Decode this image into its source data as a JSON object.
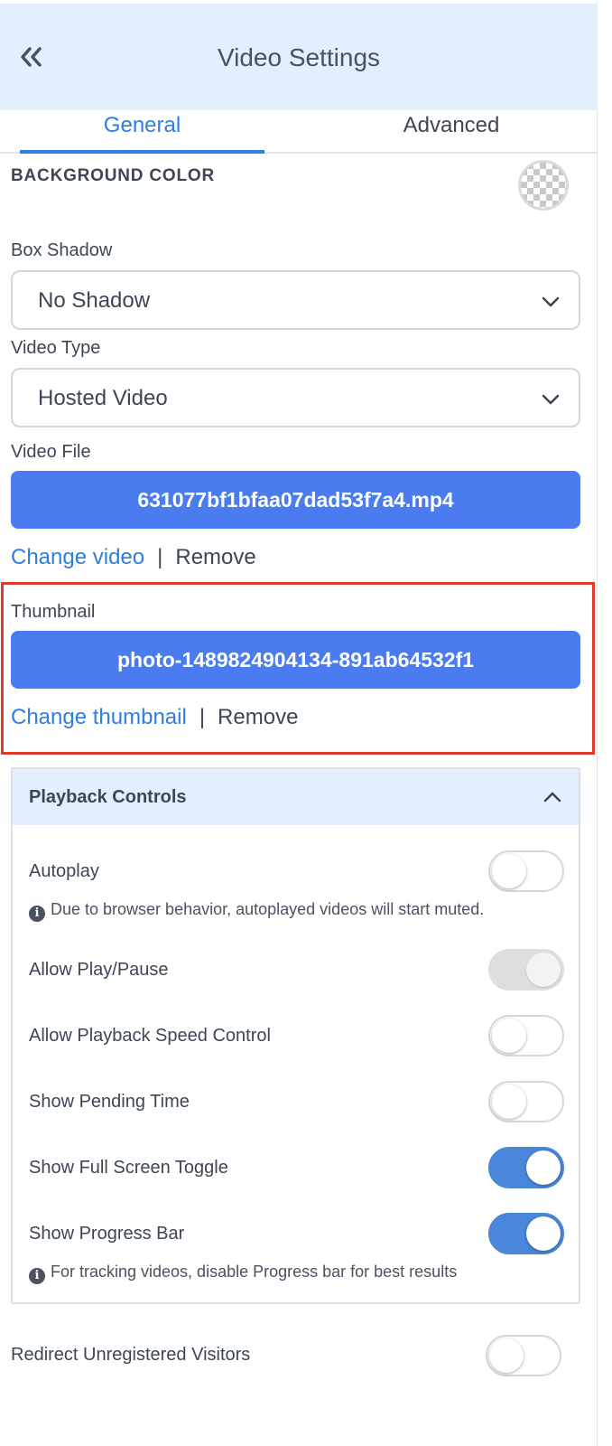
{
  "header": {
    "title": "Video Settings"
  },
  "tabs": [
    {
      "label": "General",
      "active": true
    },
    {
      "label": "Advanced",
      "active": false
    }
  ],
  "background_color": {
    "heading": "BACKGROUND COLOR"
  },
  "box_shadow": {
    "label": "Box Shadow",
    "value": "No Shadow"
  },
  "video_type": {
    "label": "Video Type",
    "value": "Hosted Video"
  },
  "video_file": {
    "label": "Video File",
    "filename": "631077bf1bfaa07dad53f7a4.mp4",
    "change_label": "Change video",
    "separator": "|",
    "remove_label": "Remove"
  },
  "thumbnail": {
    "label": "Thumbnail",
    "filename": "photo-1489824904134-891ab64532f1",
    "change_label": "Change thumbnail",
    "separator": "|",
    "remove_label": "Remove"
  },
  "playback": {
    "title": "Playback Controls",
    "autoplay": {
      "label": "Autoplay",
      "state": "off",
      "note": "Due to browser behavior, autoplayed videos will start muted."
    },
    "play_pause": {
      "label": "Allow Play/Pause",
      "state": "on-disabled"
    },
    "speed_control": {
      "label": "Allow Playback Speed Control",
      "state": "off"
    },
    "pending_time": {
      "label": "Show Pending Time",
      "state": "off"
    },
    "full_screen": {
      "label": "Show Full Screen Toggle",
      "state": "on"
    },
    "progress_bar": {
      "label": "Show Progress Bar",
      "state": "on",
      "note": "For tracking videos, disable Progress bar for best results"
    }
  },
  "redirect": {
    "label": "Redirect Unregistered Visitors",
    "state": "off"
  },
  "icons": {
    "info": "i"
  },
  "colors": {
    "accent": "#2f7de1",
    "button": "#4a7cf0",
    "toggle_on": "#4a86d9",
    "highlight": "#e03b2a",
    "header_bg": "#e3effc"
  }
}
